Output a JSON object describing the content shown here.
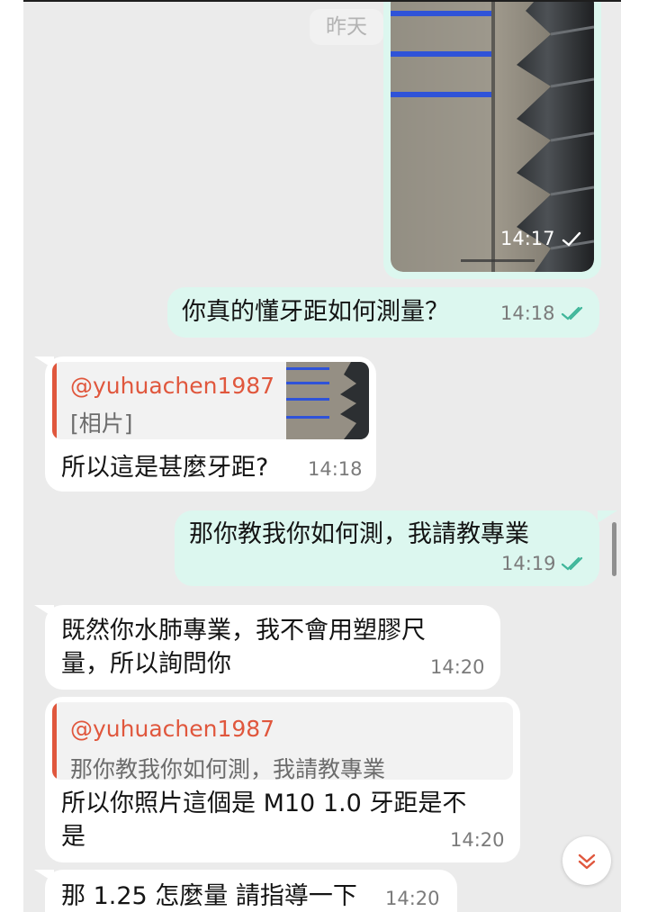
{
  "date_separator": "昨天",
  "colors": {
    "chat_bg": "#ebebeb",
    "outgoing_bubble": "#dcf7ef",
    "incoming_bubble": "#ffffff",
    "quote_name": "#e0573d",
    "read_check": "#3fb69a"
  },
  "messages": [
    {
      "id": "m1",
      "direction": "outgoing",
      "type": "photo",
      "photo_description": "close-up of bolt thread next to ruler",
      "time": "14:17",
      "status": "sent"
    },
    {
      "id": "m2",
      "direction": "outgoing",
      "text": "你真的懂牙距如何測量？",
      "time": "14:18",
      "status": "read"
    },
    {
      "id": "m3",
      "direction": "incoming",
      "reply_to": {
        "author": "@yuhuachen1987",
        "preview": "[相片]"
      },
      "text": "所以這是甚麼牙距?",
      "time": "14:18"
    },
    {
      "id": "m4",
      "direction": "outgoing",
      "text": "那你教我你如何測，我請教專業",
      "time": "14:19",
      "status": "read"
    },
    {
      "id": "m5",
      "direction": "incoming",
      "lines": [
        "既然你水肺專業，我不會用塑膠尺",
        "量，所以詢問你"
      ],
      "time": "14:20"
    },
    {
      "id": "m6",
      "direction": "incoming",
      "reply_to": {
        "author": "@yuhuachen1987",
        "preview": "那你教我你如何測，我請教專業"
      },
      "lines": [
        "所以你照片這個是 M10 1.0 牙距是不",
        "是"
      ],
      "time": "14:20"
    },
    {
      "id": "m7",
      "direction": "incoming",
      "text": "那 1.25 怎麼量 請指導一下",
      "time": "14:20"
    }
  ],
  "icons": {
    "sent": "single-check-icon",
    "read": "double-check-icon",
    "scroll_down": "double-chevron-down-icon"
  }
}
